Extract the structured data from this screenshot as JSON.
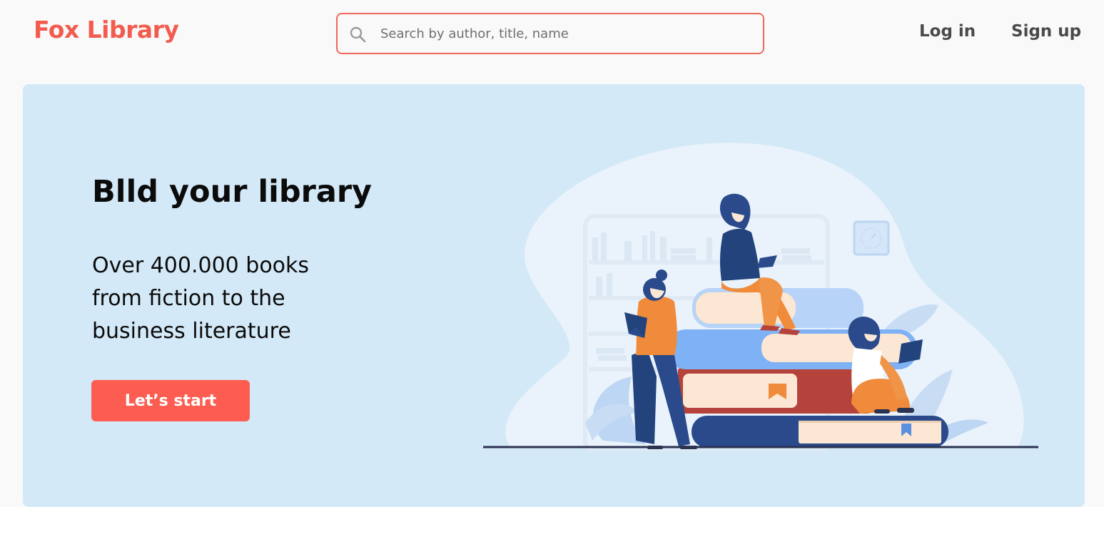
{
  "brand": {
    "name": "Fox Library",
    "color": "#f25c4f"
  },
  "search": {
    "placeholder": "Search by author, title, name",
    "value": "",
    "icon": "search-icon"
  },
  "nav": {
    "login_label": "Log in",
    "signup_label": "Sign up"
  },
  "hero": {
    "title": "Blld your library",
    "subtitle": "Over 400.000 books from fiction to the business literature",
    "cta_label": "Let’s start",
    "background": "#d4e9f7",
    "cta_color": "#fc5d50"
  }
}
